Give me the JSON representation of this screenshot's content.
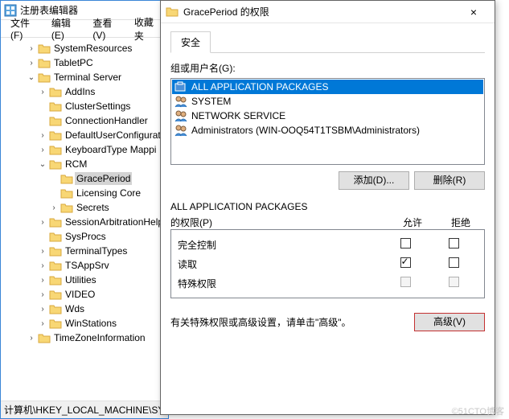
{
  "regedit": {
    "title": "注册表编辑器",
    "menu": {
      "file": "文件(F)",
      "edit": "编辑(E)",
      "view": "查看(V)",
      "favorites": "收藏夹"
    },
    "tree": [
      {
        "label": "SystemResources",
        "indent": 2,
        "exp": ">"
      },
      {
        "label": "TabletPC",
        "indent": 2,
        "exp": ">"
      },
      {
        "label": "Terminal Server",
        "indent": 2,
        "exp": "v"
      },
      {
        "label": "AddIns",
        "indent": 3,
        "exp": ">"
      },
      {
        "label": "ClusterSettings",
        "indent": 3,
        "exp": ""
      },
      {
        "label": "ConnectionHandler",
        "indent": 3,
        "exp": ""
      },
      {
        "label": "DefaultUserConfigurat",
        "indent": 3,
        "exp": ">"
      },
      {
        "label": "KeyboardType Mappi",
        "indent": 3,
        "exp": ">"
      },
      {
        "label": "RCM",
        "indent": 3,
        "exp": "v"
      },
      {
        "label": "GracePeriod",
        "indent": 4,
        "exp": "",
        "selected": true
      },
      {
        "label": "Licensing Core",
        "indent": 4,
        "exp": ""
      },
      {
        "label": "Secrets",
        "indent": 4,
        "exp": ">"
      },
      {
        "label": "SessionArbitrationHelp",
        "indent": 3,
        "exp": ">"
      },
      {
        "label": "SysProcs",
        "indent": 3,
        "exp": ""
      },
      {
        "label": "TerminalTypes",
        "indent": 3,
        "exp": ">"
      },
      {
        "label": "TSAppSrv",
        "indent": 3,
        "exp": ">"
      },
      {
        "label": "Utilities",
        "indent": 3,
        "exp": ">"
      },
      {
        "label": "VIDEO",
        "indent": 3,
        "exp": ">"
      },
      {
        "label": "Wds",
        "indent": 3,
        "exp": ">"
      },
      {
        "label": "WinStations",
        "indent": 3,
        "exp": ">"
      },
      {
        "label": "TimeZoneInformation",
        "indent": 2,
        "exp": ">"
      }
    ],
    "status": "计算机\\HKEY_LOCAL_MACHINE\\SYS"
  },
  "perm": {
    "title": "GracePeriod 的权限",
    "close": "×",
    "tab": "安全",
    "group_label": "组或用户名(G):",
    "users": [
      {
        "name": "ALL APPLICATION PACKAGES",
        "selected": true
      },
      {
        "name": "SYSTEM"
      },
      {
        "name": "NETWORK SERVICE"
      },
      {
        "name": "Administrators (WIN-OOQ54T1TSBM\\Administrators)"
      }
    ],
    "add_btn": "添加(D)...",
    "remove_btn": "删除(R)",
    "perm_for_prefix": "ALL APPLICATION PACKAGES",
    "perm_for_suffix": "的权限(P)",
    "col_allow": "允许",
    "col_deny": "拒绝",
    "perms": [
      {
        "label": "完全控制",
        "allow": false,
        "deny": false,
        "disabled": false
      },
      {
        "label": "读取",
        "allow": true,
        "deny": false,
        "disabled": false
      },
      {
        "label": "特殊权限",
        "allow": false,
        "deny": false,
        "disabled": true
      }
    ],
    "advanced_text": "有关特殊权限或高级设置，请单击\"高级\"。",
    "advanced_btn": "高级(V)"
  },
  "watermark": "©51CTO博客"
}
